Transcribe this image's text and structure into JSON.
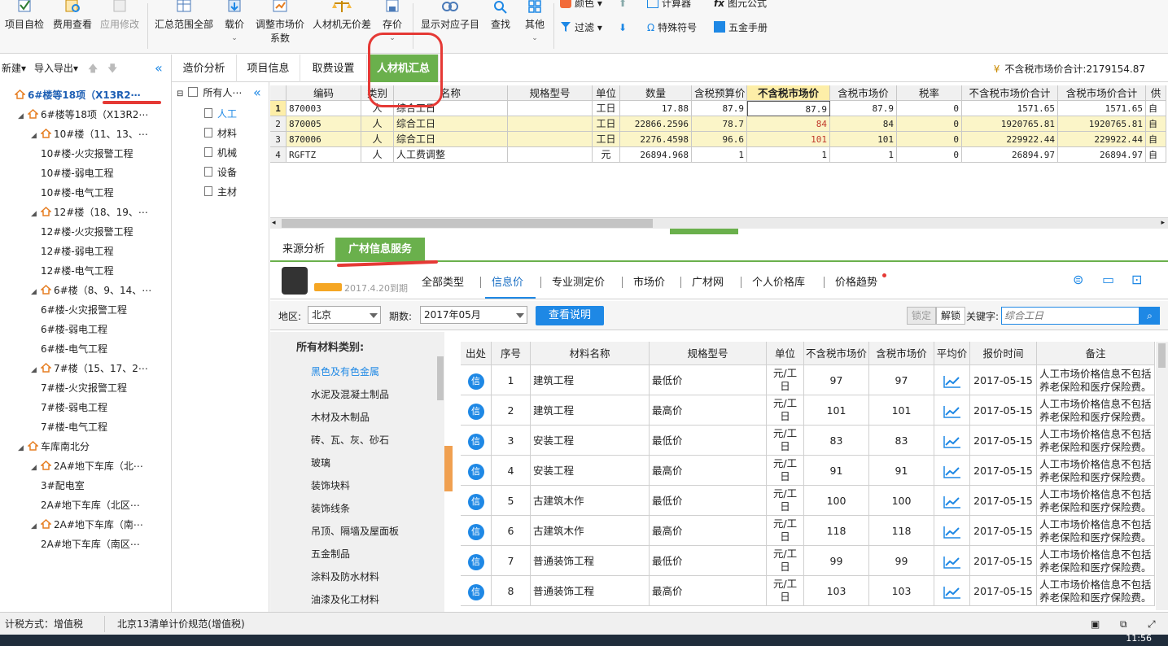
{
  "toolbar": {
    "project_check": "项目自检",
    "fee_view": "费用查看",
    "apply_modify": "应用修改",
    "summary_all": "汇总范围全部",
    "load_price": "载价",
    "adjust_market_1": "调整市场价",
    "adjust_market_2": "系数",
    "no_price_diff": "人材机无价差",
    "save_price": "存价",
    "show_subitems": "显示对应子目",
    "find": "查找",
    "other": "其他",
    "color": "颜色",
    "filter": "过滤",
    "calculator": "计算器",
    "formula": "图元公式",
    "special_symbol": "特殊符号",
    "hardware_manual": "五金手册"
  },
  "left": {
    "new": "新建",
    "import_export": "导入导出",
    "tree": [
      {
        "label": "6#楼等18项（X13R2⋯",
        "level": 0,
        "bold": true
      },
      {
        "label": "6#楼等18项（X13R2⋯",
        "level": 1
      },
      {
        "label": "10#楼（11、13、⋯",
        "level": 2
      },
      {
        "label": "10#楼-火灾报警工程",
        "level": 3
      },
      {
        "label": "10#楼-弱电工程",
        "level": 3
      },
      {
        "label": "10#楼-电气工程",
        "level": 3
      },
      {
        "label": "12#楼（18、19、⋯",
        "level": 2
      },
      {
        "label": "12#楼-火灾报警工程",
        "level": 3
      },
      {
        "label": "12#楼-弱电工程",
        "level": 3
      },
      {
        "label": "12#楼-电气工程",
        "level": 3
      },
      {
        "label": "6#楼（8、9、14、⋯",
        "level": 2
      },
      {
        "label": "6#楼-火灾报警工程",
        "level": 3
      },
      {
        "label": "6#楼-弱电工程",
        "level": 3
      },
      {
        "label": "6#楼-电气工程",
        "level": 3
      },
      {
        "label": "7#楼（15、17、2⋯",
        "level": 2
      },
      {
        "label": "7#楼-火灾报警工程",
        "level": 3
      },
      {
        "label": "7#楼-弱电工程",
        "level": 3
      },
      {
        "label": "7#楼-电气工程",
        "level": 3
      },
      {
        "label": "车库南北分",
        "level": 1
      },
      {
        "label": "2A#地下车库（北⋯",
        "level": 2
      },
      {
        "label": "3#配电室",
        "level": 3
      },
      {
        "label": "2A#地下车库（北区⋯",
        "level": 3
      },
      {
        "label": "2A#地下车库（南⋯",
        "level": 2
      },
      {
        "label": "2A#地下车库（南区⋯",
        "level": 3
      }
    ]
  },
  "mid": {
    "root": "所有人⋯",
    "items": [
      "人工",
      "材料",
      "机械",
      "设备",
      "主材"
    ]
  },
  "tabs": [
    "造价分析",
    "项目信息",
    "取费设置",
    "人材机汇总"
  ],
  "summary_text": "不含税市场价合计:2179154.87",
  "grid": {
    "headers": [
      "",
      "编码",
      "类别",
      "名称",
      "规格型号",
      "单位",
      "数量",
      "含税预算价",
      "不含税市场价",
      "含税市场价",
      "税率",
      "不含税市场价合计",
      "含税市场价合计",
      "供"
    ],
    "rows": [
      [
        "1",
        "870003",
        "人",
        "综合工日",
        "",
        "工日",
        "17.88",
        "87.9",
        "87.9",
        "87.9",
        "0",
        "1571.65",
        "1571.65",
        "自"
      ],
      [
        "2",
        "870005",
        "人",
        "综合工日",
        "",
        "工日",
        "22866.2596",
        "78.7",
        "84",
        "84",
        "0",
        "1920765.81",
        "1920765.81",
        "自"
      ],
      [
        "3",
        "870006",
        "人",
        "综合工日",
        "",
        "工日",
        "2276.4598",
        "96.6",
        "101",
        "101",
        "0",
        "229922.44",
        "229922.44",
        "自"
      ],
      [
        "4",
        "RGFTZ",
        "人",
        "人工费调整",
        "",
        "元",
        "26894.968",
        "1",
        "1",
        "1",
        "0",
        "26894.97",
        "26894.97",
        "自"
      ]
    ]
  },
  "lower_tabs": [
    "来源分析",
    "广材信息服务"
  ],
  "service": {
    "expire": "2017.4.20到期",
    "tabs": [
      "全部类型",
      "信息价",
      "专业测定价",
      "市场价",
      "广材网",
      "个人价格库",
      "价格趋势"
    ]
  },
  "filter": {
    "region_label": "地区:",
    "region": "北京",
    "period_label": "期数:",
    "period": "2017年05月",
    "view_desc": "查看说明",
    "lock": "锁定",
    "unlock": "解锁",
    "keyword_label": "关键字:",
    "keyword_placeholder": "综合工日"
  },
  "categories": {
    "title": "所有材料类别:",
    "items": [
      "黑色及有色金属",
      "水泥及混凝土制品",
      "木材及木制品",
      "砖、瓦、灰、砂石",
      "玻璃",
      "装饰块料",
      "装饰线条",
      "吊顶、隔墙及屋面板",
      "五金制品",
      "涂料及防水材料",
      "油漆及化工材料"
    ]
  },
  "materials": {
    "headers": [
      "出处",
      "序号",
      "材料名称",
      "规格型号",
      "单位",
      "不含税市场价",
      "含税市场价",
      "平均价",
      "报价时间",
      "备注"
    ],
    "source_badge": "信",
    "unit_line1": "元/工",
    "unit_line2": "日",
    "note_line1": "人工市场价格信息不包括",
    "note_line2": "养老保险和医疗保险费。",
    "rows": [
      {
        "no": "1",
        "name": "建筑工程",
        "spec": "最低价",
        "price": "97",
        "tax_price": "97",
        "date": "2017-05-15"
      },
      {
        "no": "2",
        "name": "建筑工程",
        "spec": "最高价",
        "price": "101",
        "tax_price": "101",
        "date": "2017-05-15"
      },
      {
        "no": "3",
        "name": "安装工程",
        "spec": "最低价",
        "price": "83",
        "tax_price": "83",
        "date": "2017-05-15"
      },
      {
        "no": "4",
        "name": "安装工程",
        "spec": "最高价",
        "price": "91",
        "tax_price": "91",
        "date": "2017-05-15"
      },
      {
        "no": "5",
        "name": "古建筑木作",
        "spec": "最低价",
        "price": "100",
        "tax_price": "100",
        "date": "2017-05-15"
      },
      {
        "no": "6",
        "name": "古建筑木作",
        "spec": "最高价",
        "price": "118",
        "tax_price": "118",
        "date": "2017-05-15"
      },
      {
        "no": "7",
        "name": "普通装饰工程",
        "spec": "最低价",
        "price": "99",
        "tax_price": "99",
        "date": "2017-05-15"
      },
      {
        "no": "8",
        "name": "普通装饰工程",
        "spec": "最高价",
        "price": "103",
        "tax_price": "103",
        "date": "2017-05-15"
      }
    ]
  },
  "status": {
    "tax_method": "计税方式：增值税",
    "standard": "北京13清单计价规范(增值税)"
  },
  "clock": "11:56"
}
